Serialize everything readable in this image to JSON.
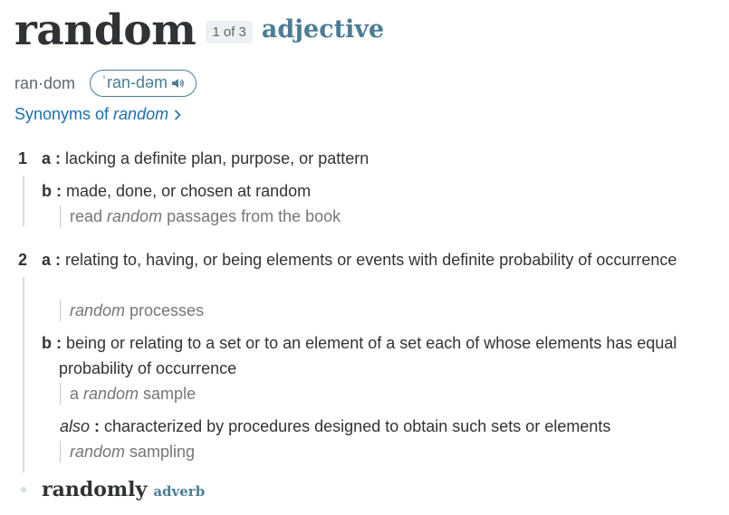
{
  "entry": {
    "headword": "random",
    "homograph": "1 of 3",
    "part_of_speech": "adjective",
    "hyphenation": "ran·dom",
    "pronunciation": "ˈran-dəm",
    "synonyms_link": {
      "prefix": "Synonyms of",
      "word": "random"
    }
  },
  "senses": [
    {
      "number": "1",
      "subsenses": [
        {
          "letter": "a",
          "text": "lacking a definite plan, purpose, or pattern",
          "examples": []
        },
        {
          "letter": "b",
          "text": "made, done, or chosen at random",
          "examples": [
            {
              "before": "read ",
              "italic": "random",
              "after": " passages from the book"
            }
          ]
        }
      ]
    },
    {
      "number": "2",
      "subsenses": [
        {
          "letter": "a",
          "text": "relating to, having, or being elements or events with definite probability of occurrence",
          "examples": [
            {
              "before": "",
              "italic": "random",
              "after": " processes"
            }
          ]
        },
        {
          "letter": "b",
          "text": "being or relating to a set or to an element of a set each of whose elements has equal probability of occurrence",
          "examples": [
            {
              "before": "a ",
              "italic": "random",
              "after": " sample"
            }
          ]
        },
        {
          "letter": "also",
          "text": "characterized by procedures designed to obtain such sets or elements",
          "examples": [
            {
              "before": "",
              "italic": "random",
              "after": " sampling"
            }
          ]
        }
      ]
    }
  ],
  "run_on": {
    "word": "randomly",
    "part_of_speech": "adverb"
  },
  "icons": {
    "pronunciation": "speaker-icon",
    "synonyms": "chevron-right-icon"
  },
  "colors": {
    "accent": "#4a7d95",
    "link": "#1a6fb0",
    "text": "#303336",
    "example": "#767676"
  }
}
